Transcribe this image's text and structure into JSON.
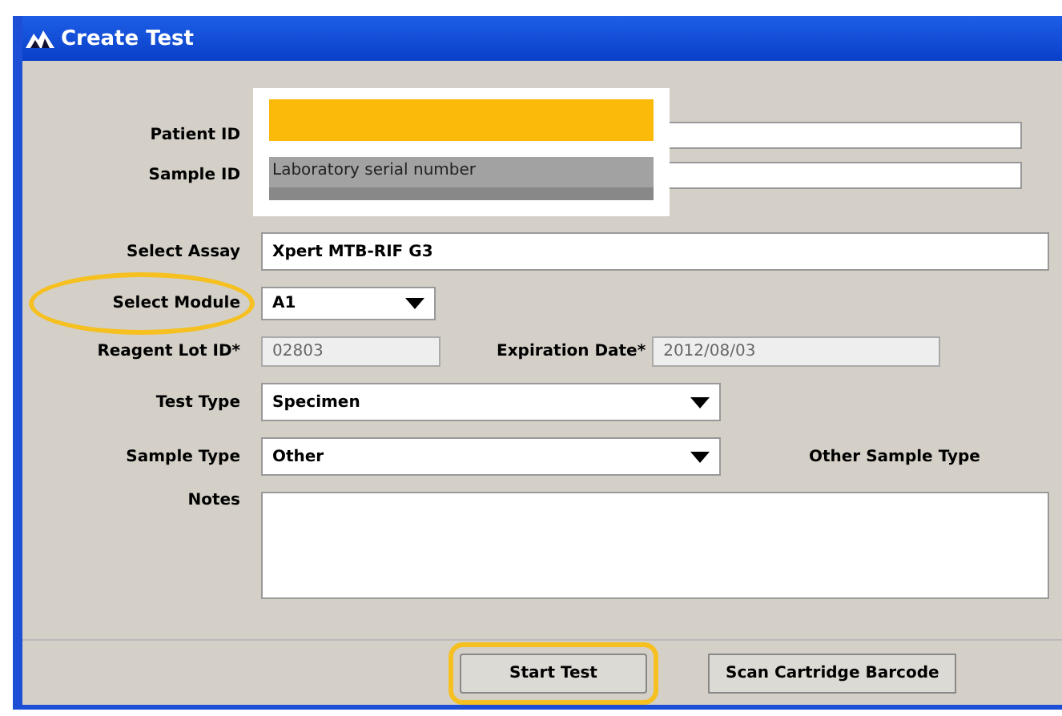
{
  "window": {
    "title": "Create Test"
  },
  "fields": [
    {
      "kind": "text",
      "label": "Patient ID"
    },
    {
      "kind": "text",
      "label": "Sample ID"
    },
    {
      "kind": "wide",
      "label": "Select Assay",
      "value": "Xpert MTB-RIF G3"
    },
    {
      "kind": "combo-small",
      "label": "Select Module",
      "value": "A1",
      "highlighted": true
    },
    {
      "kind": "lot",
      "label": "Reagent Lot ID*",
      "value": "02803",
      "extra_label": "Expiration Date*",
      "extra_value": "2012/08/03",
      "disabled": true
    },
    {
      "kind": "combo",
      "label": "Test Type",
      "value": "Specimen"
    },
    {
      "kind": "combo",
      "label": "Sample Type",
      "value": "Other",
      "extra_label": "Other Sample Type"
    },
    {
      "kind": "notes",
      "label": "Notes"
    }
  ],
  "callout": {
    "text": "Laboratory serial number"
  },
  "buttons": [
    {
      "label": "Start Test",
      "highlighted": true
    },
    {
      "label": "Scan Cartridge Barcode",
      "highlighted": false
    }
  ]
}
